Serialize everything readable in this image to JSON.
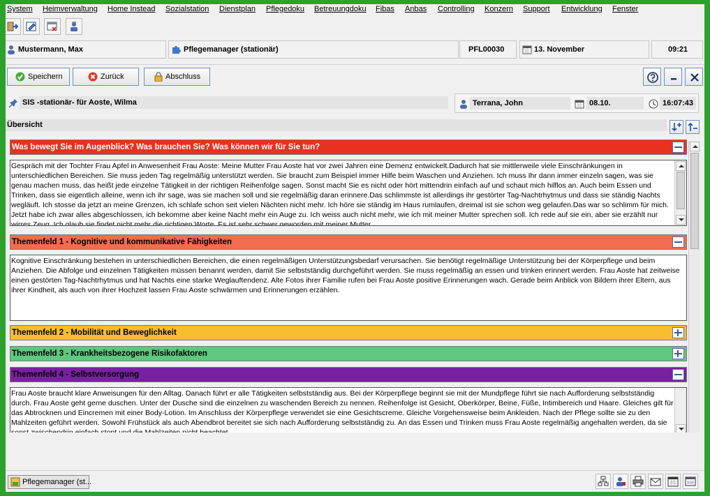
{
  "menu": [
    "System",
    "Heimverwaltung",
    "Home Instead",
    "Sozialstation",
    "Dienstplan",
    "Pflegedoku",
    "Betreuungdoku",
    "Fibas",
    "Anbas",
    "Controlling",
    "Konzern",
    "Support",
    "Entwicklung",
    "Fenster"
  ],
  "toolbar_icons": [
    "exit-icon",
    "edit-form-icon",
    "close-window-icon",
    "user-contact-icon"
  ],
  "header": {
    "user": "Mustermann, Max",
    "module": "Pflegemanager (stationär)",
    "code": "PFL00030",
    "date": "13. November",
    "time": "09:21"
  },
  "actions": {
    "save": "Speichern",
    "back": "Zurück",
    "finish": "Abschluss"
  },
  "info": {
    "document": "SIS -stationär- für Aoste, Wilma",
    "author": "Terrana, John",
    "date": "08.10.",
    "time": "16:07:43"
  },
  "overview_label": "Übersicht",
  "colors": {
    "section_intro": "#e8311f",
    "section_1": "#f26c4f",
    "section_2": "#f6bd2f",
    "section_3": "#5fc77f",
    "section_4": "#7b1fa2",
    "window_frame": "#2ca12c"
  },
  "sections": [
    {
      "title": "Was bewegt Sie im Augenblick? Was brauchen Sie? Was können wir für Sie tun?",
      "expanded": true,
      "text": "Gespräch mit der Tochter Frau Apfel in Anwesenheit Frau Aoste: Meine Mutter Frau Aoste hat vor zwei Jahren eine Demenz entwickelt.Dadurch hat sie mittlerweile viele Einschränkungen in unterschiedlichen Bereichen. Sie muss jeden Tag regelmäßig unterstützt werden. Sie braucht zum Beispiel immer Hilfe beim Waschen und Anziehen. Ich muss Ihr dann immer einzeln sagen, was sie genau machen muss, das heißt jede einzelne Tätigkeit in der richtigen Reihenfolge sagen. Sonst macht Sie es nicht oder hört mittendrin einfach auf und schaut mich hilflos an. Auch beim Essen und Trinken, dass sie eigentlich alleine, wenn ich ihr sage, was sie machen soll und sie regelmäßig daran erinnere.Das schlimmste ist allerdings ihr gestörter Tag-Nachtrhytmus und dass sie ständig Nachts wegläuft. Ich stosse da jetzt an meine Grenzen, ich schlafe schon seit vielen Nächten nicht mehr. Ich höre sie ständig im Haus rumlaufen, dreimal ist sie schon weg gelaufen.Das war so schlimm für mich. Jetzt habe ich zwar alles abgeschlossen, ich bekomme aber keine Nacht mehr ein Auge zu. Ich weiss auch nicht mehr, wie ich mit meiner Mutter sprechen soll. Ich rede auf sie ein, aber sie erzählt nur wirres Zeug. Ich glaub sie findet nicht mehr die richtigen Worte. Es ist sehr schwer geworden mit meiner Mutter."
    },
    {
      "title": "Themenfeld 1 - Kognitive und kommunikative Fähigkeiten",
      "expanded": true,
      "text": "Kognitive Einschränkung bestehen in unterschiedlichen Bereichen, die einen regelmäßigen Unterstützungsbedarf verursachen. Sie benötigt regelmäßige Unterstützung bei der Körperpflege und beim Anziehen. Die Abfolge und einzelnen Tätigkeiten müssen benannt werden, damit Sie selbstständig durchgeführt werden. Sie muss regelmäßig an essen und trinken erinnert werden. Frau Aoste hat zeitweise einen gestörten Tag-Nachtrhytmus und hat Nachts eine starke Weglauftendenz. Alte Fotos ihrer Familie rufen bei Frau Aoste positive Erinnerungen wach. Gerade beim Anblick von Bildern ihrer Eltern, aus ihrer Kindheit, als auch von ihrer Hochzeit lassen Frau Aoste schwärmen und Erinnerungen erzählen."
    },
    {
      "title": "Themenfeld 2 - Mobilität und Beweglichkeit",
      "expanded": false,
      "text": ""
    },
    {
      "title": "Themenfeld 3 - Krankheitsbezogene Risikofaktoren",
      "expanded": false,
      "text": ""
    },
    {
      "title": "Themenfeld 4 - Selbstversorgung",
      "expanded": true,
      "text": "Frau Aoste braucht klare Anweisungen für den Alltag. Danach führt er alle Tätigkeiten selbstständig aus. Bei der Körperpflege beginnt sie mit der Mundpflege führt sie nach Aufforderung selbstständig durch. Frau Aoste geht gerne duschen. Unter der Dusche sind die einzelnen zu waschenden Bereich zu nennen. Reihenfolge ist Gesicht, Oberkörper, Beine, Füße, Intimbereich und Haare. Gleiches gilt für das Abtrocknen und Eincremen mit einer Body-Lotion. Im Anschluss der Körperpflege verwendet sie eine Gesichtscreme. Gleiche Vorgehensweise beim Ankleiden. Nach der Pflege sollte sie zu den Mahlzeiten geführt werden. Sowohl Frühstück als auch Abendbrot bereitet sie sich nach Aufforderung selbstständig zu. An das Essen und Trinken muss Frau Aoste regelmäßig angehalten werden, da sie sonst zwischendrin einfach stopt und die Mahlzeiten nicht beachtet."
    }
  ],
  "taskbar": {
    "window_label": "Pflegemanager (st..."
  },
  "bottom_icons": [
    "hierarchy-icon",
    "user-edit-icon",
    "printer-icon",
    "mail-icon",
    "calendar-icon",
    "window-icon"
  ]
}
